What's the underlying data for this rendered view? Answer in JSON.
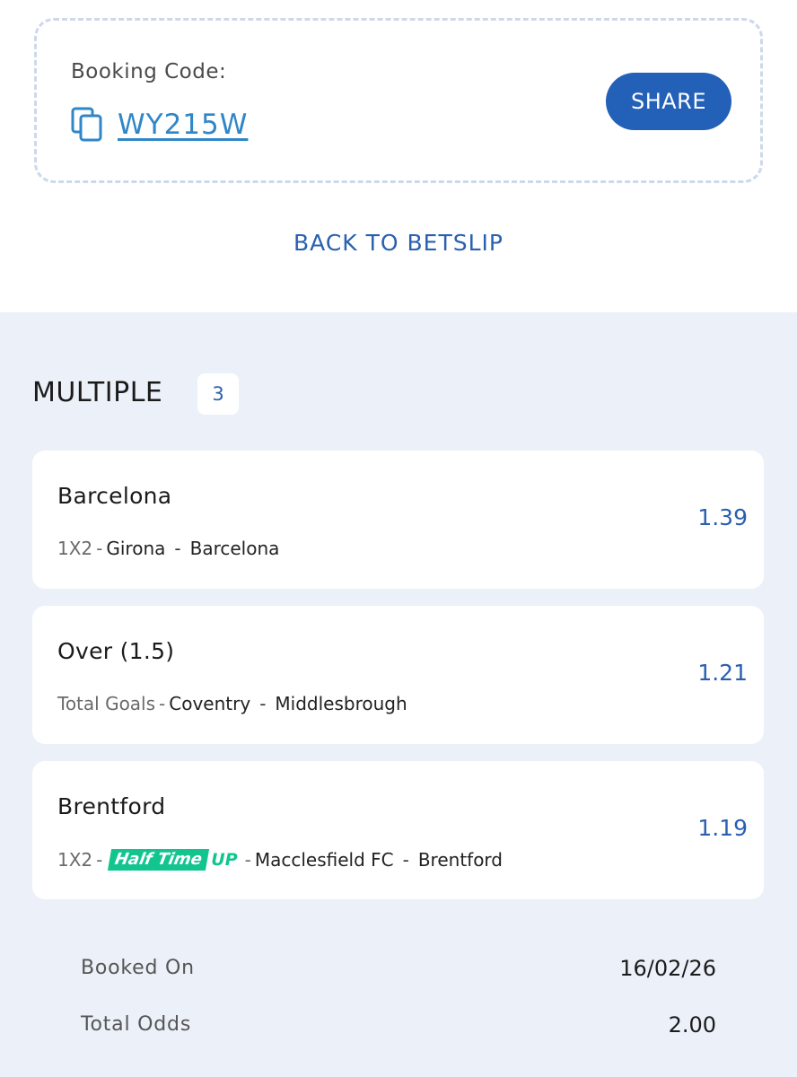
{
  "booking": {
    "label": "Booking Code:",
    "code": "WY215W",
    "share_label": "SHARE",
    "back_label": "BACK TO BETSLIP"
  },
  "section": {
    "title": "MULTIPLE",
    "count": "3"
  },
  "bets": [
    {
      "selection": "Barcelona",
      "market": "1X2",
      "home": "Girona",
      "away": "Barcelona",
      "odds": "1.39"
    },
    {
      "selection": "Over (1.5)",
      "market": "Total Goals",
      "home": "Coventry",
      "away": "Middlesbrough",
      "odds": "1.21"
    },
    {
      "selection": "Brentford",
      "market": "1X2",
      "promo_badge_main": "Half Time",
      "promo_badge_suffix": "UP",
      "home": "Macclesfield FC",
      "away": "Brentford",
      "odds": "1.19"
    }
  ],
  "summary": {
    "booked_on_label": "Booked On",
    "booked_on_value": "16/02/26",
    "total_odds_label": "Total Odds",
    "total_odds_value": "2.00"
  },
  "colors": {
    "primary": "#2360b8",
    "link": "#2f86c8",
    "odds": "#2a5fb0",
    "promo": "#12c58e",
    "background": "#ebf0f9"
  },
  "icons": {
    "copy": "copy-icon"
  }
}
